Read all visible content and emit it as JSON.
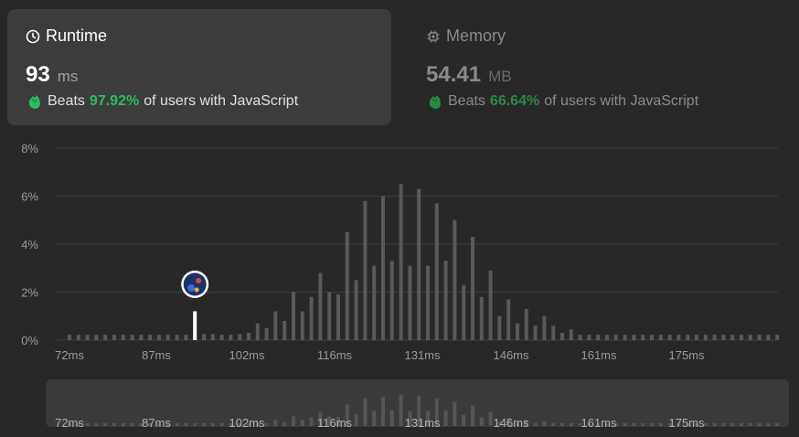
{
  "runtime": {
    "title": "Runtime",
    "value": "93",
    "unit": "ms",
    "beats_prefix": "Beats",
    "beats_pct": "97.92%",
    "beats_suffix": "of users with JavaScript"
  },
  "memory": {
    "title": "Memory",
    "value": "54.41",
    "unit": "MB",
    "beats_prefix": "Beats",
    "beats_pct": "66.64%",
    "beats_suffix": "of users with JavaScript"
  },
  "colors": {
    "background": "#282828",
    "accent_green": "#2cbb5d",
    "bar": "#595959",
    "highlight_bar": "#ffffff",
    "grid": "#3e3e3e"
  },
  "chart_data": {
    "type": "bar",
    "xlabel": "",
    "ylabel": "",
    "ylim": [
      0,
      8
    ],
    "y_unit": "%",
    "y_ticks": [
      "8%",
      "6%",
      "4%",
      "2%",
      "0%"
    ],
    "x_tick_labels": [
      "72ms",
      "87ms",
      "102ms",
      "116ms",
      "131ms",
      "146ms",
      "161ms",
      "175ms"
    ],
    "highlight_value": "93",
    "grid": true,
    "values": [
      0.22,
      0.22,
      0.22,
      0.22,
      0.22,
      0.22,
      0.22,
      0.22,
      0.22,
      0.22,
      0.22,
      0.22,
      0.22,
      0.22,
      0.22,
      0.25,
      0.25,
      0.22,
      0.22,
      0.25,
      0.3,
      0.7,
      0.5,
      1.2,
      0.8,
      2.0,
      1.2,
      1.8,
      2.8,
      2.0,
      1.9,
      4.5,
      2.5,
      5.8,
      3.1,
      6.0,
      3.3,
      6.5,
      3.1,
      6.3,
      3.1,
      5.7,
      3.3,
      5.0,
      2.3,
      4.3,
      1.8,
      2.9,
      1.0,
      1.7,
      0.7,
      1.3,
      0.6,
      1.0,
      0.6,
      0.3,
      0.45,
      0.22,
      0.22,
      0.22,
      0.22,
      0.22,
      0.22,
      0.22,
      0.22,
      0.22,
      0.22,
      0.22,
      0.22,
      0.22,
      0.22,
      0.22,
      0.22,
      0.22,
      0.22,
      0.22,
      0.22,
      0.22,
      0.22,
      0.22
    ]
  }
}
